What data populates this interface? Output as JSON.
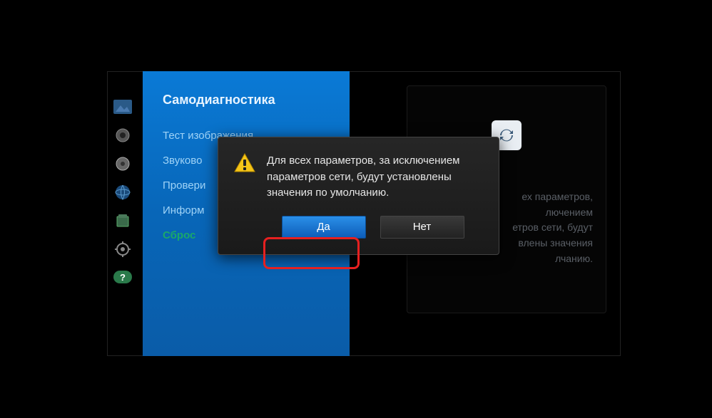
{
  "panel": {
    "title": "Самодиагностика",
    "items": [
      "Тест изображения",
      "Звуково",
      "Провери",
      "Информ",
      "Сброс"
    ]
  },
  "right": {
    "line1": "ех параметров,",
    "line2": "лючением",
    "line3": "етров сети, будут",
    "line4": "влены значения",
    "line5": "лчанию."
  },
  "dialog": {
    "message": "Для всех параметров, за исключением параметров сети, будут установлены значения по умолчанию.",
    "yes": "Да",
    "no": "Нет"
  },
  "icons": {
    "picture": "picture",
    "sound": "sound",
    "channel": "channel",
    "network": "network",
    "system": "system",
    "settings": "settings",
    "support": "support"
  }
}
